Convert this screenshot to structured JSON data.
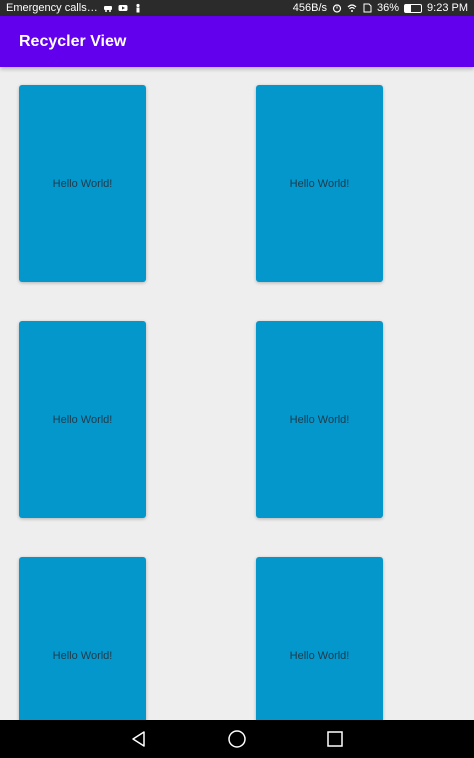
{
  "status_bar": {
    "carrier_text": "Emergency calls…",
    "icons_left": [
      "car-icon",
      "youtube-icon",
      "person-icon"
    ],
    "net_speed": "456B/s",
    "icons_right": [
      "alarm-icon",
      "wifi-icon",
      "sim-icon"
    ],
    "battery_percent_label": "36%",
    "battery_level": 0.36,
    "time": "9:23 PM"
  },
  "app_bar": {
    "title": "Recycler View"
  },
  "cards": [
    {
      "label": "Hello World!"
    },
    {
      "label": "Hello World!"
    },
    {
      "label": "Hello World!"
    },
    {
      "label": "Hello World!"
    },
    {
      "label": "Hello World!"
    },
    {
      "label": "Hello World!"
    }
  ],
  "nav_bar": {
    "buttons": [
      "back-icon",
      "home-icon",
      "recents-icon"
    ]
  },
  "colors": {
    "app_bar": "#6200ee",
    "card": "#0497cc",
    "background": "#eeeeee"
  }
}
